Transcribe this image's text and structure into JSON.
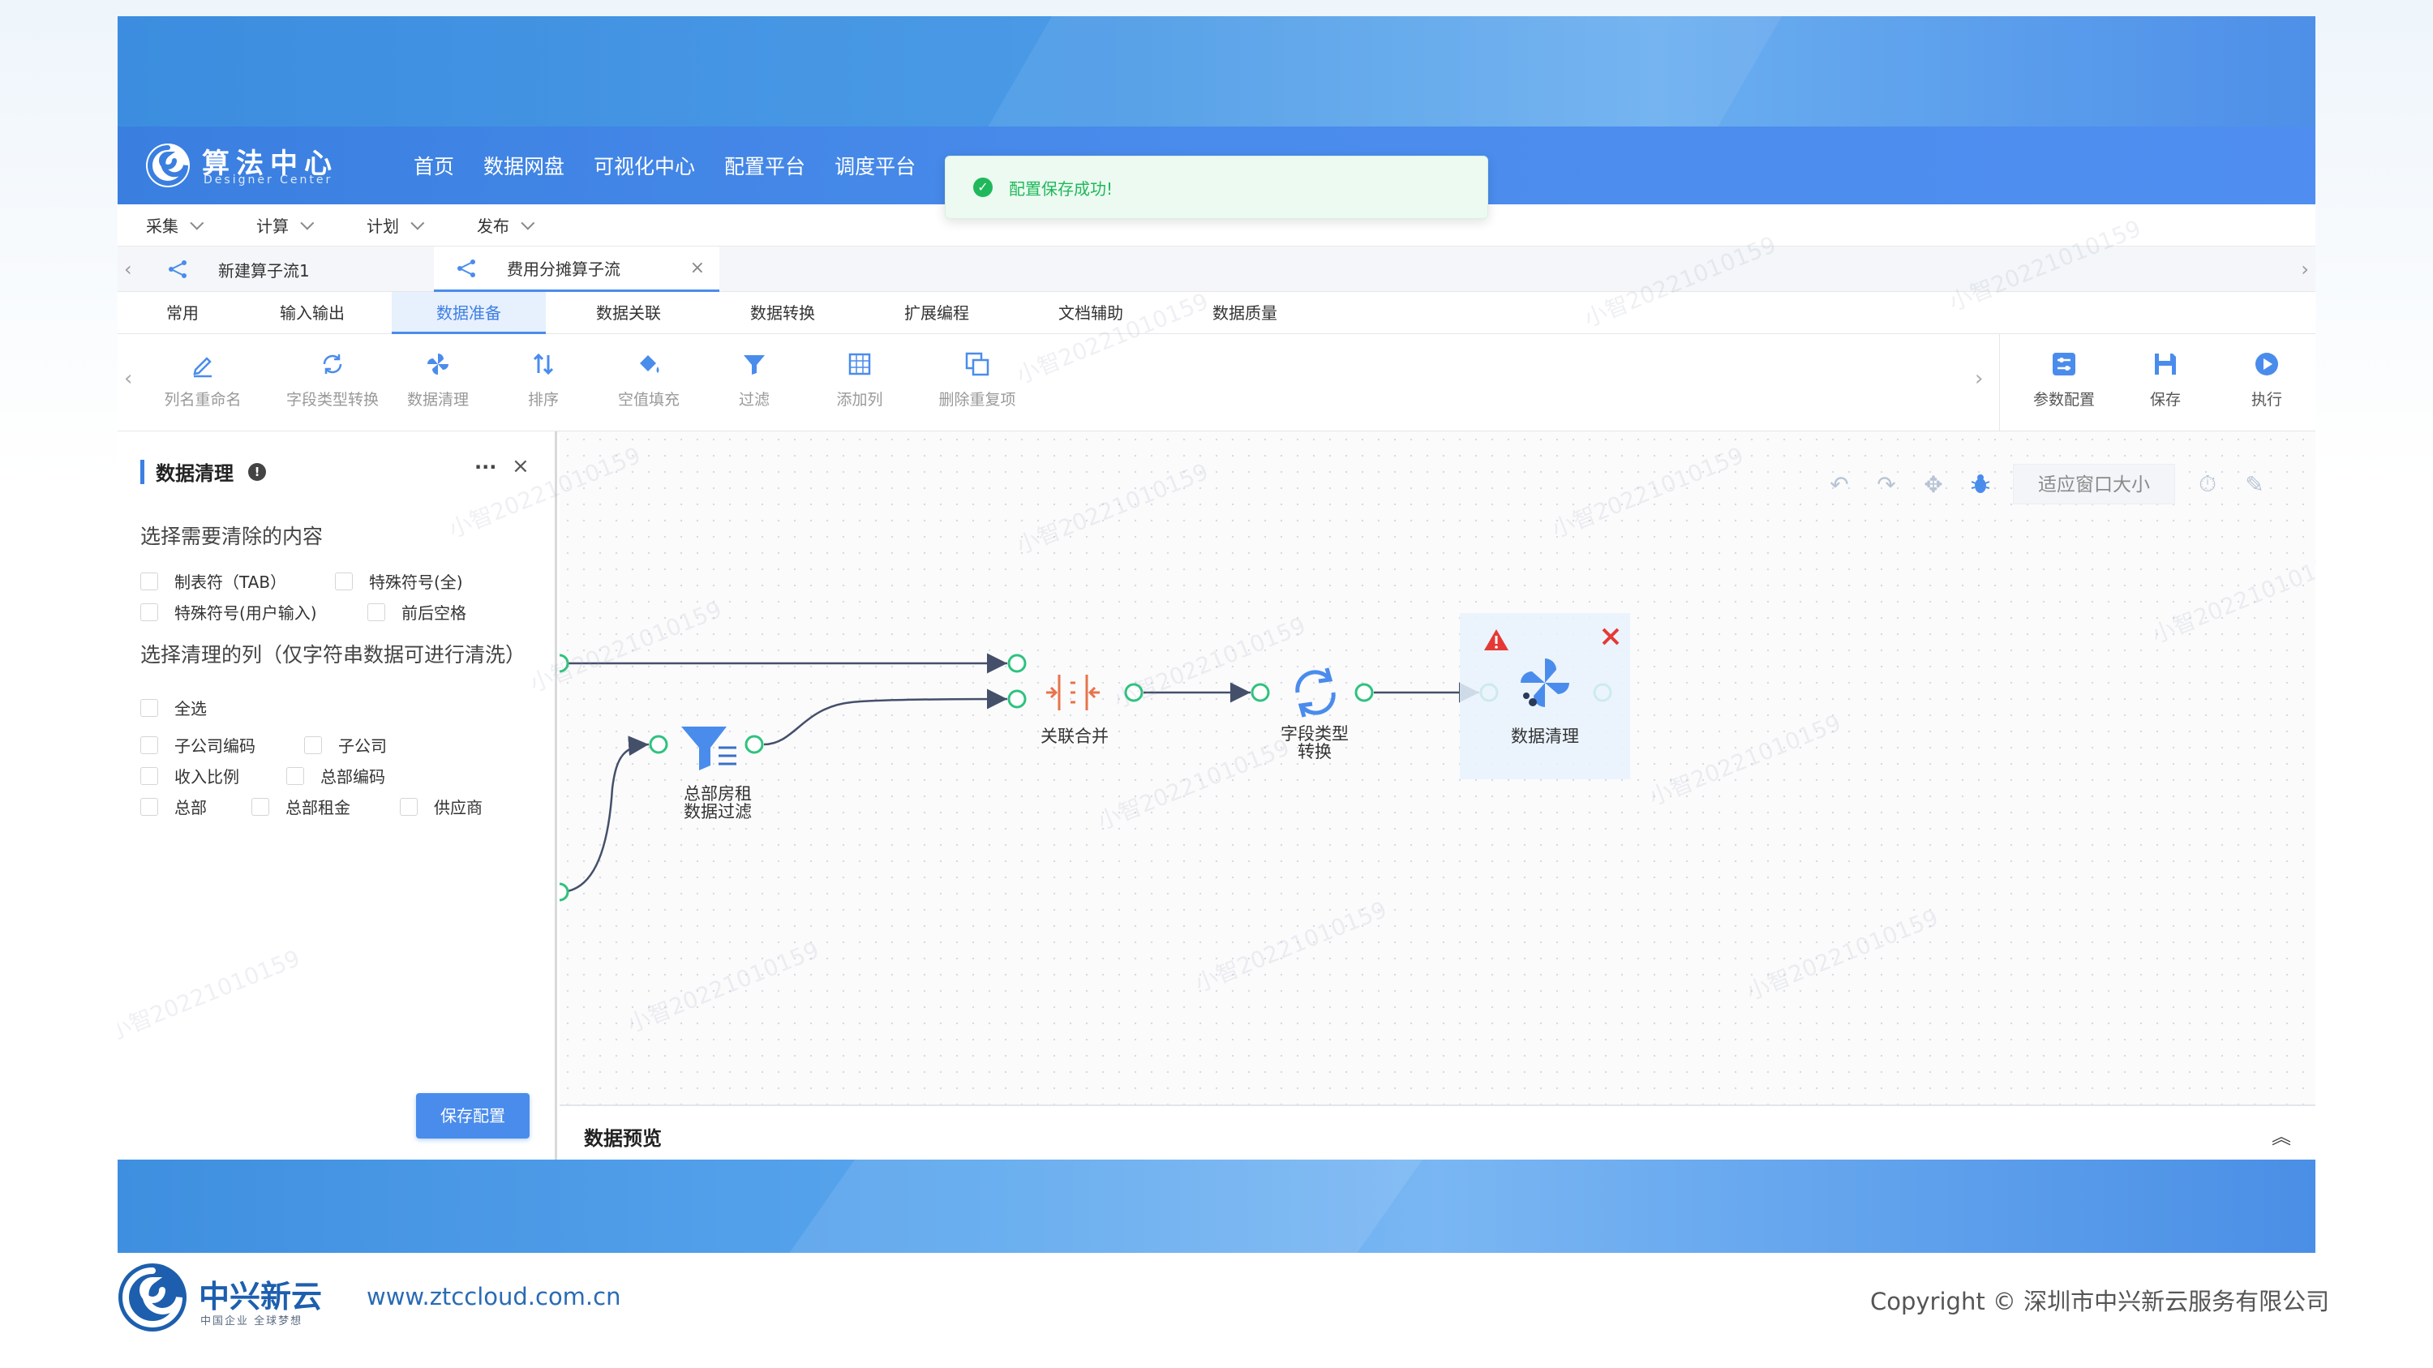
{
  "header": {
    "logo_title": "算法中心",
    "logo_sub": "Designer Center",
    "nav": [
      "首页",
      "数据网盘",
      "可视化中心",
      "配置平台",
      "调度平台"
    ]
  },
  "toast": {
    "message": "配置保存成功!"
  },
  "menubar": [
    "采集",
    "计算",
    "计划",
    "发布"
  ],
  "tabs": [
    {
      "label": "新建算子流1",
      "close": "×"
    },
    {
      "label": "费用分摊算子流",
      "close": "×"
    }
  ],
  "category_tabs": [
    "常用",
    "输入输出",
    "数据准备",
    "数据关联",
    "数据转换",
    "扩展编程",
    "文档辅助",
    "数据质量"
  ],
  "tools": [
    "列名重命名",
    "字段类型转换",
    "数据清理",
    "排序",
    "空值填充",
    "过滤",
    "添加列",
    "删除重复项"
  ],
  "actions": [
    "参数配置",
    "保存",
    "执行"
  ],
  "panel": {
    "title": "数据清理",
    "more": "···",
    "close": "×",
    "section1": "选择需要清除的内容",
    "content_options": [
      "制表符（TAB）",
      "特殊符号(全)",
      "特殊符号(用户输入)",
      "前后空格"
    ],
    "section2": "选择清理的列（仅字符串数据可进行清洗）",
    "select_all": "全选",
    "columns": [
      "子公司编码",
      "子公司",
      "收入比例",
      "总部编码",
      "总部",
      "总部租金",
      "供应商"
    ],
    "save_button": "保存配置"
  },
  "canvas": {
    "fit_button": "适应窗口大小",
    "nodes": {
      "filter": {
        "line1": "总部房租",
        "line2": "数据过滤"
      },
      "merge": {
        "line1": "关联合并"
      },
      "convert": {
        "line1": "字段类型",
        "line2": "转换"
      },
      "clean": {
        "line1": "数据清理"
      }
    }
  },
  "preview": {
    "title": "数据预览"
  },
  "watermark": "小智20221010159",
  "footer": {
    "brand": "中兴新云",
    "slogan": "中国企业 全球梦想",
    "url": "www.ztccloud.com.cn",
    "copyright": "Copyright © 深圳市中兴新云服务有限公司"
  },
  "colors": {
    "primary": "#4a8cec",
    "success": "#1fb85b",
    "alert": "#e53935",
    "merge_node": "#e8734a",
    "flow_node": "#4a8cec"
  }
}
